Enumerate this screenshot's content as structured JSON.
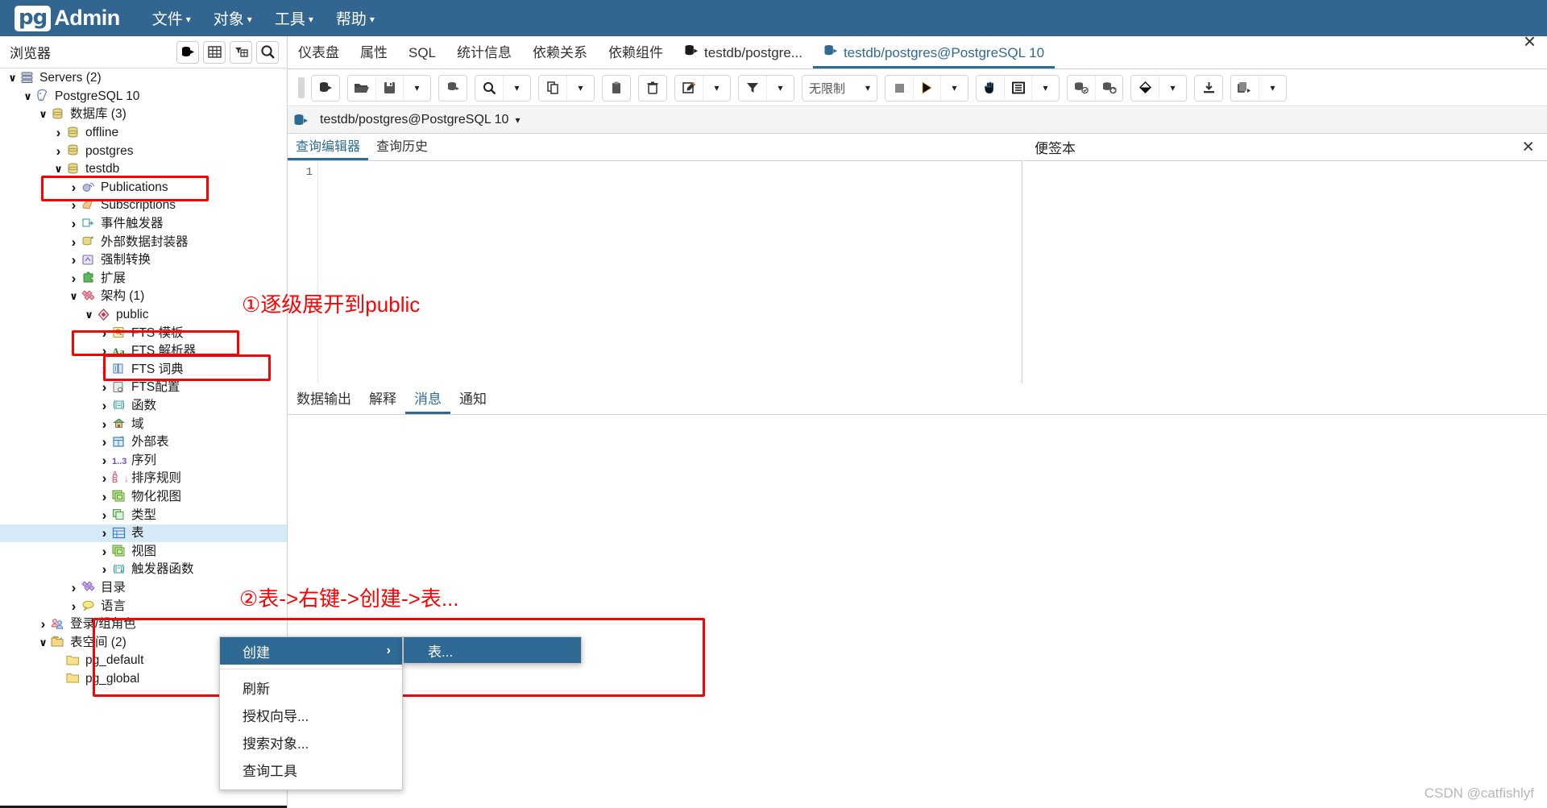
{
  "app": {
    "logo_pg": "pg",
    "logo_admin": "Admin",
    "menus": [
      {
        "label": "文件",
        "icon": "chevron-down-icon"
      },
      {
        "label": "对象",
        "icon": "chevron-down-icon"
      },
      {
        "label": "工具",
        "icon": "chevron-down-icon"
      },
      {
        "label": "帮助",
        "icon": "chevron-down-icon"
      }
    ]
  },
  "browser": {
    "title": "浏览器",
    "buttons": [
      "server-filter-icon",
      "grid-icon",
      "filter-table-icon",
      "search-icon"
    ]
  },
  "tree": [
    {
      "depth": 0,
      "arrow": "open",
      "icon": "servers-icon",
      "label": "Servers (2)"
    },
    {
      "depth": 1,
      "arrow": "open",
      "icon": "postgresql-icon",
      "label": "PostgreSQL 10"
    },
    {
      "depth": 2,
      "arrow": "open",
      "icon": "database-icon",
      "label": "数据库 (3)"
    },
    {
      "depth": 3,
      "arrow": "closed",
      "icon": "database-icon",
      "label": "offline"
    },
    {
      "depth": 3,
      "arrow": "closed",
      "icon": "database-icon",
      "label": "postgres"
    },
    {
      "depth": 3,
      "arrow": "open",
      "icon": "database-icon",
      "label": "testdb"
    },
    {
      "depth": 4,
      "arrow": "closed",
      "icon": "publication-icon",
      "label": "Publications"
    },
    {
      "depth": 4,
      "arrow": "closed",
      "icon": "subscription-icon",
      "label": "Subscriptions"
    },
    {
      "depth": 4,
      "arrow": "closed",
      "icon": "event-trigger-icon",
      "label": "事件触发器"
    },
    {
      "depth": 4,
      "arrow": "closed",
      "icon": "fdw-icon",
      "label": "外部数据封装器"
    },
    {
      "depth": 4,
      "arrow": "closed",
      "icon": "cast-icon",
      "label": "强制转换"
    },
    {
      "depth": 4,
      "arrow": "closed",
      "icon": "extension-icon",
      "label": "扩展"
    },
    {
      "depth": 4,
      "arrow": "open",
      "icon": "schema-group-icon",
      "label": "架构 (1)"
    },
    {
      "depth": 5,
      "arrow": "open",
      "icon": "schema-icon",
      "label": "public"
    },
    {
      "depth": 6,
      "arrow": "closed",
      "icon": "fts-template-icon",
      "label": "FTS 模板"
    },
    {
      "depth": 6,
      "arrow": "closed",
      "icon": "fts-parser-icon",
      "label": "FTS 解析器"
    },
    {
      "depth": 6,
      "arrow": "closed",
      "icon": "fts-dict-icon",
      "label": "FTS 词典"
    },
    {
      "depth": 6,
      "arrow": "closed",
      "icon": "fts-config-icon",
      "label": "FTS配置"
    },
    {
      "depth": 6,
      "arrow": "closed",
      "icon": "function-icon",
      "label": "函数"
    },
    {
      "depth": 6,
      "arrow": "closed",
      "icon": "domain-icon",
      "label": "域"
    },
    {
      "depth": 6,
      "arrow": "closed",
      "icon": "foreign-table-icon",
      "label": "外部表"
    },
    {
      "depth": 6,
      "arrow": "closed",
      "icon": "sequence-icon",
      "label": "序列"
    },
    {
      "depth": 6,
      "arrow": "closed",
      "icon": "collation-icon",
      "label": "排序规则"
    },
    {
      "depth": 6,
      "arrow": "closed",
      "icon": "matview-icon",
      "label": "物化视图"
    },
    {
      "depth": 6,
      "arrow": "closed",
      "icon": "type-icon",
      "label": "类型"
    },
    {
      "depth": 6,
      "arrow": "closed",
      "icon": "table-icon",
      "label": "表",
      "selected": true
    },
    {
      "depth": 6,
      "arrow": "closed",
      "icon": "view-icon",
      "label": "视图"
    },
    {
      "depth": 6,
      "arrow": "closed",
      "icon": "trigger-function-icon",
      "label": "触发器函数"
    },
    {
      "depth": 4,
      "arrow": "closed",
      "icon": "catalog-icon",
      "label": "目录"
    },
    {
      "depth": 4,
      "arrow": "closed",
      "icon": "language-icon",
      "label": "语言"
    },
    {
      "depth": 2,
      "arrow": "closed",
      "icon": "role-icon",
      "label": "登录/组角色"
    },
    {
      "depth": 2,
      "arrow": "open",
      "icon": "tablespace-icon",
      "label": "表空间 (2)"
    },
    {
      "depth": 3,
      "arrow": "none",
      "icon": "folder-icon",
      "label": "pg_default"
    },
    {
      "depth": 3,
      "arrow": "none",
      "icon": "folder-icon",
      "label": "pg_global"
    }
  ],
  "annotations": [
    {
      "text": "①逐级展开到public"
    },
    {
      "text": "②表->右键->创建->表..."
    }
  ],
  "context_menu": {
    "items": [
      {
        "label": "创建",
        "highlighted": true,
        "submenu_icon": "chevron-right-icon"
      },
      {
        "label": "刷新"
      },
      {
        "label": "授权向导..."
      },
      {
        "label": "搜索对象..."
      },
      {
        "label": "查询工具"
      }
    ],
    "submenu": [
      {
        "label": "表..."
      }
    ]
  },
  "tabs": [
    {
      "label": "仪表盘",
      "active": false
    },
    {
      "label": "属性",
      "active": false
    },
    {
      "label": "SQL",
      "active": false
    },
    {
      "label": "统计信息",
      "active": false
    },
    {
      "label": "依赖关系",
      "active": false
    },
    {
      "label": "依赖组件",
      "active": false
    },
    {
      "label": "testdb/postgre...",
      "active": false,
      "icon": "database-connect-icon"
    },
    {
      "label": "testdb/postgres@PostgreSQL 10",
      "active": true,
      "icon": "database-connect-icon"
    }
  ],
  "tab_close": "×",
  "toolbar": {
    "groups": [
      {
        "buttons": [
          {
            "icon": "open-connection-icon"
          }
        ]
      },
      {
        "buttons": [
          {
            "icon": "folder-open-icon"
          },
          {
            "icon": "save-icon"
          },
          {
            "icon": "chevron-down-icon"
          }
        ]
      },
      {
        "buttons": [
          {
            "icon": "db-copy-icon"
          }
        ]
      },
      {
        "buttons": [
          {
            "icon": "search-icon"
          },
          {
            "icon": "chevron-down-icon"
          }
        ]
      },
      {
        "buttons": [
          {
            "icon": "copy-icon"
          },
          {
            "icon": "chevron-down-icon"
          }
        ]
      },
      {
        "buttons": [
          {
            "icon": "paste-icon"
          }
        ]
      },
      {
        "buttons": [
          {
            "icon": "trash-icon"
          }
        ]
      },
      {
        "buttons": [
          {
            "icon": "edit-icon"
          },
          {
            "icon": "chevron-down-icon"
          }
        ]
      },
      {
        "buttons": [
          {
            "icon": "filter-icon"
          },
          {
            "icon": "chevron-down-icon"
          }
        ]
      }
    ],
    "limit_select": {
      "value": "无限制",
      "icon": "chevron-down-icon"
    },
    "groups2": [
      {
        "buttons": [
          {
            "icon": "stop-icon"
          },
          {
            "icon": "play-icon"
          },
          {
            "icon": "chevron-down-icon"
          }
        ]
      },
      {
        "buttons": [
          {
            "icon": "pointer-icon"
          },
          {
            "icon": "explain-icon"
          },
          {
            "icon": "chevron-down-icon"
          }
        ]
      },
      {
        "buttons": [
          {
            "icon": "commit-icon"
          },
          {
            "icon": "rollback-icon"
          }
        ]
      },
      {
        "buttons": [
          {
            "icon": "clear-icon"
          },
          {
            "icon": "chevron-down-icon"
          }
        ]
      },
      {
        "buttons": [
          {
            "icon": "download-icon"
          }
        ]
      },
      {
        "buttons": [
          {
            "icon": "macro-icon"
          },
          {
            "icon": "chevron-down-icon"
          }
        ]
      }
    ]
  },
  "connection_bar": {
    "icon": "database-connect-icon",
    "label": "testdb/postgres@PostgreSQL 10",
    "caret": "chevron-down-icon"
  },
  "query_tabs": [
    {
      "label": "查询编辑器",
      "active": true
    },
    {
      "label": "查询历史",
      "active": false
    }
  ],
  "editor": {
    "line_number": "1",
    "content": ""
  },
  "scratch": {
    "title": "便签本",
    "close": "×"
  },
  "output_tabs": [
    {
      "label": "数据输出",
      "active": false
    },
    {
      "label": "解释",
      "active": false
    },
    {
      "label": "消息",
      "active": true
    },
    {
      "label": "通知",
      "active": false
    }
  ],
  "watermark": "CSDN @catfishlyf"
}
